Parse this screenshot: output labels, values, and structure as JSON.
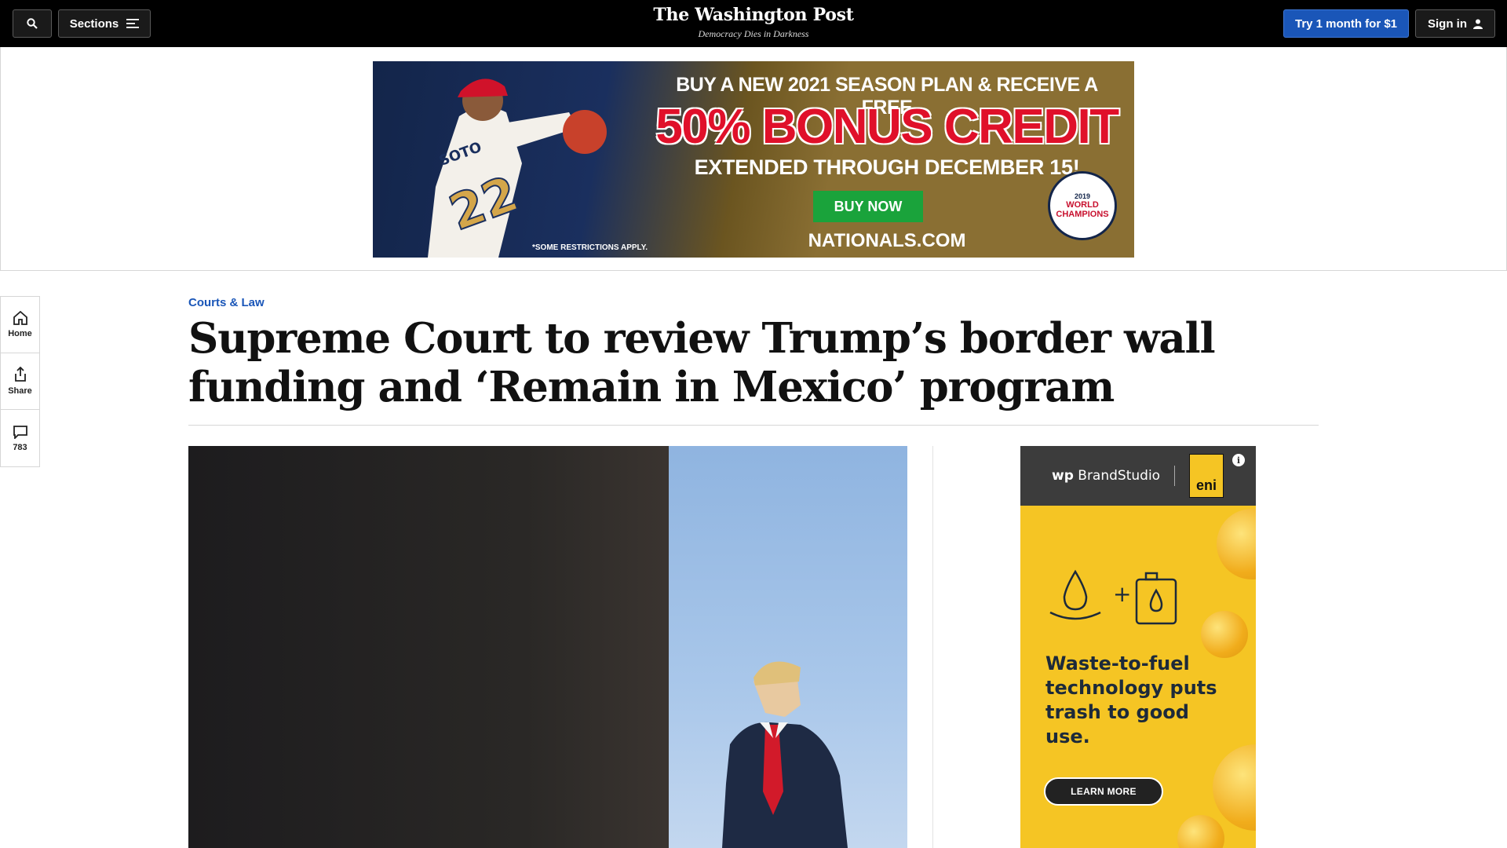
{
  "header": {
    "search_icon": "search-icon",
    "sections_label": "Sections",
    "masthead": "The Washington Post",
    "tagline": "Democracy Dies in Darkness",
    "try_label": "Try 1 month for $1",
    "signin_label": "Sign in"
  },
  "banner_ad": {
    "line1": "BUY A NEW 2021 SEASON PLAN & RECEIVE A FREE",
    "line2": "50% BONUS CREDIT",
    "line3": "EXTENDED THROUGH DECEMBER 15!",
    "button": "BUY NOW",
    "site": "NATIONALS.COM",
    "restrictions": "*SOME RESTRICTIONS APPLY.",
    "badge_year": "2019",
    "badge_text": "WORLD CHAMPIONS",
    "jersey_name": "SOTO",
    "jersey_number": "22"
  },
  "rail": {
    "items": [
      {
        "label": "Home",
        "icon": "home-icon"
      },
      {
        "label": "Share",
        "icon": "share-icon"
      },
      {
        "label": "783",
        "icon": "comment-icon"
      }
    ]
  },
  "article": {
    "kicker": "Courts & Law",
    "headline": "Supreme Court to review Trump’s border wall funding and ‘Remain in Mexico’ program"
  },
  "side_ad": {
    "brand": "BrandStudio",
    "brand_prefix": "wp",
    "sponsor": "eni",
    "copy": "Waste-to-fuel technology puts trash to good use.",
    "cta": "LEARN MORE",
    "info": "i"
  },
  "colors": {
    "accent_blue": "#1a56b8",
    "topbar": "#000000",
    "ad_yellow": "#f5c524"
  }
}
